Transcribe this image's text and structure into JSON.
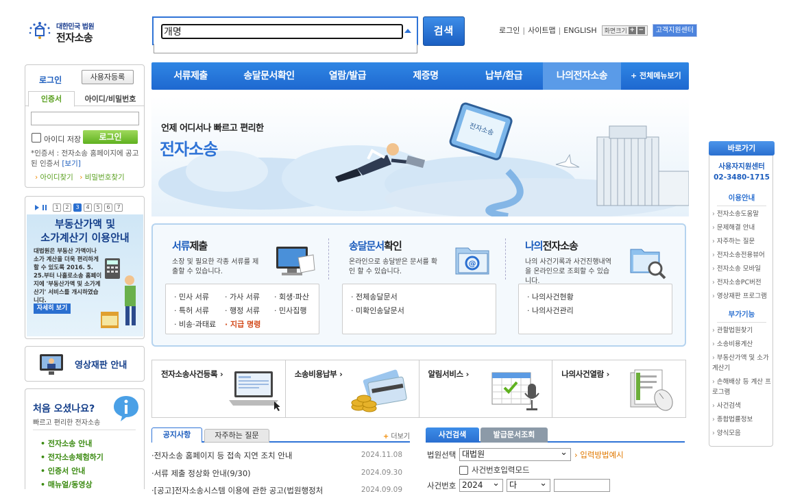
{
  "header": {
    "logo_small": "대한민국 법원",
    "logo_big": "전자소송",
    "search_value": "개명",
    "search_button": "검색",
    "util": [
      "로그인",
      "사이트맵",
      "ENGLISH"
    ],
    "font_size_label": "화면크기",
    "font_plus": "+",
    "font_minus": "−",
    "support": "고객지원센터"
  },
  "nav": {
    "items": [
      "서류제출",
      "송달문서확인",
      "열람/발급",
      "제증명",
      "납부/환급",
      "나의전자소송"
    ],
    "all_menu": "+ 전체메뉴보기"
  },
  "login": {
    "title": "로그인",
    "register": "사용자등록",
    "tab_cert": "인증서",
    "tab_id": "아이디/비밀번호",
    "save_id": "아이디 저장",
    "login_btn": "로그인",
    "note_a": "*인증서 : 전자소송 홈페이지에 공고된 인증서 ",
    "note_link": "[보기]",
    "find_id": "아이디찾기",
    "find_pw": "비밀번호찾기"
  },
  "promo": {
    "pages": [
      "1",
      "2",
      "3",
      "4",
      "5",
      "6",
      "7"
    ],
    "current": "3",
    "heading_1": "부동산가액 및",
    "heading_2": "소가계산기 이용안내",
    "desc": "대법원은 부동산 가액이나 소가 계산을 더욱 편리하게 할 수 있도록 2016. 5. 25.부터 나홀로소송 홈페이지에 '부동산가액 및 소가계산기' 서비스를 개시하였습니다.",
    "more": "자세히 보기"
  },
  "video": {
    "label": "영상재판 안내"
  },
  "first_visit": {
    "title": "처음 오셨나요?",
    "subtitle": "빠르고 편리한 전자소송",
    "items": [
      "전자소송 안내",
      "전자소송체험하기",
      "인증서 안내",
      "매뉴얼/동영상"
    ]
  },
  "hero": {
    "tagline": "언제 어디서나 빠르고 편리한",
    "title": "전자소송"
  },
  "services": [
    {
      "title_em": "서류",
      "title_rest": "제출",
      "desc": "소장 및 필요한 각종 서류를 제출할 수 있습니다.",
      "links": [
        "민사 서류",
        "가사 서류",
        "회생·파산",
        "특허 서류",
        "행정 서류",
        "민사집행",
        "비송·과태료",
        "지급 명령"
      ]
    },
    {
      "title_em": "송달문서",
      "title_rest": "확인",
      "desc": "온라인으로 송달받은 문서를 확인 할 수 있습니다.",
      "links": [
        "전체송달문서",
        "미확인송달문서"
      ]
    },
    {
      "title_em": "나의",
      "title_rest": "전자소송",
      "desc": "나의 사건기록과 사건진행내역을 온라인으로 조회할 수 있습니다.",
      "links": [
        "나의사건현황",
        "나의사건관리"
      ]
    }
  ],
  "quick": [
    "전자소송사건등록",
    "소송비용납부",
    "알림서비스",
    "나의사건열람"
  ],
  "notices": {
    "tab_active": "공지사항",
    "tab_other": "자주하는 질문",
    "more": "더보기",
    "rows": [
      {
        "title": "·전자소송 홈페이지 등 접속 지연 조치 안내",
        "date": "2024.11.08"
      },
      {
        "title": "·서류 제출 정상화 안내(9/30)",
        "date": "2024.09.30"
      },
      {
        "title": "·[공고]전자소송시스템 이용에 관한 공고(법원행정처",
        "date": "2024.09.09"
      }
    ]
  },
  "case_search": {
    "tab_active": "사건검색",
    "tab_other": "발급문서조회",
    "court_label": "법원선택",
    "court_value": "대법원",
    "input_example": "입력방법예시",
    "mode_label": "사건번호입력모드",
    "number_label": "사건번호",
    "year_value": "2024",
    "type_value": "다"
  },
  "right_quick": {
    "header": "바로가기",
    "center_1": "사용자지원센터",
    "center_2": "02-3480-1715",
    "sec1": "이용안내",
    "items1": [
      "전자소송도움말",
      "문제해결 안내",
      "자주하는 질문",
      "전자소송전용뷰어",
      "전자소송 모바일",
      "전자소송PC버전",
      "영상재판 프로그램"
    ],
    "sec2": "부가기능",
    "items2": [
      "관할법원찾기",
      "소송비용계산",
      "부동산가액 및 소가계산기",
      "손해배상 등 계산 프로그램",
      "사건검색",
      "종합법률정보",
      "양식모음"
    ]
  }
}
